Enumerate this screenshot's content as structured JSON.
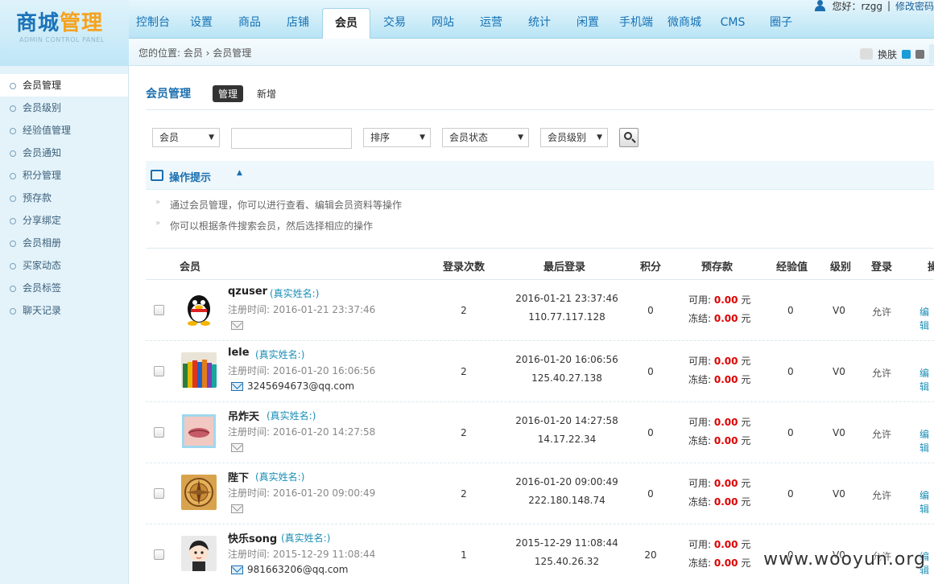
{
  "logo": {
    "part1": "商城",
    "part2": "管理",
    "sub": "ADMIN CONTROL PANEL"
  },
  "nav": {
    "tabs": [
      "控制台",
      "设置",
      "商品",
      "店铺",
      "会员",
      "交易",
      "网站",
      "运营",
      "统计",
      "闲置",
      "手机端",
      "微商城",
      "CMS",
      "圈子"
    ]
  },
  "user": {
    "greeting": "您好：rzgg",
    "change_password": "修改密码"
  },
  "breadcrumb": "您的位置: 会员 › 会员管理",
  "skin": {
    "label": "换肤",
    "colors": [
      "#1b9bd7",
      "#777777"
    ]
  },
  "sidebar": {
    "items": [
      "会员管理",
      "会员级别",
      "经验值管理",
      "会员通知",
      "积分管理",
      "预存款",
      "分享绑定",
      "会员相册",
      "买家动态",
      "会员标签",
      "聊天记录"
    ]
  },
  "page": {
    "title": "会员管理",
    "tab_manage": "管理",
    "tab_new": "新增"
  },
  "filters": {
    "member": "会员",
    "sort": "排序",
    "status": "会员状态",
    "level": "会员级别"
  },
  "tips": {
    "title": "操作提示",
    "lines": [
      "通过会员管理，你可以进行查看、编辑会员资料等操作",
      "你可以根据条件搜索会员，然后选择相应的操作"
    ]
  },
  "table": {
    "headers": {
      "member": "会员",
      "logins": "登录次数",
      "last_login": "最后登录",
      "points": "积分",
      "deposit": "预存款",
      "exp": "经验值",
      "level": "级别",
      "login": "登录"
    },
    "rows": [
      {
        "username": "qzuser",
        "realname": "(真实姓名:)",
        "regtime": "注册时间: 2016-01-21 23:37:46",
        "email": "",
        "logins": "2",
        "last_time": "2016-01-21 23:37:46",
        "last_ip": "110.77.117.128",
        "points": "0",
        "available_label": "可用:",
        "available_value": "0.00",
        "available_unit": "元",
        "frozen_label": "冻结:",
        "frozen_value": "0.00",
        "frozen_unit": "元",
        "exp": "0",
        "level": "V0",
        "login": "允许",
        "action": "编辑"
      },
      {
        "username": "lele",
        "realname": "(真实姓名:)",
        "regtime": "注册时间: 2016-01-20 16:06:56",
        "email": "3245694673@qq.com",
        "logins": "2",
        "last_time": "2016-01-20 16:06:56",
        "last_ip": "125.40.27.138",
        "points": "0",
        "available_label": "可用:",
        "available_value": "0.00",
        "available_unit": "元",
        "frozen_label": "冻结:",
        "frozen_value": "0.00",
        "frozen_unit": "元",
        "exp": "0",
        "level": "V0",
        "login": "允许",
        "action": "编辑"
      },
      {
        "username": "吊炸天",
        "realname": "(真实姓名:)",
        "regtime": "注册时间: 2016-01-20 14:27:58",
        "email": "",
        "logins": "2",
        "last_time": "2016-01-20 14:27:58",
        "last_ip": "14.17.22.34",
        "points": "0",
        "available_label": "可用:",
        "available_value": "0.00",
        "available_unit": "元",
        "frozen_label": "冻结:",
        "frozen_value": "0.00",
        "frozen_unit": "元",
        "exp": "0",
        "level": "V0",
        "login": "允许",
        "action": "编辑"
      },
      {
        "username": "陛下",
        "realname": "(真实姓名:)",
        "regtime": "注册时间: 2016-01-20 09:00:49",
        "email": "",
        "logins": "2",
        "last_time": "2016-01-20 09:00:49",
        "last_ip": "222.180.148.74",
        "points": "0",
        "available_label": "可用:",
        "available_value": "0.00",
        "available_unit": "元",
        "frozen_label": "冻结:",
        "frozen_value": "0.00",
        "frozen_unit": "元",
        "exp": "0",
        "level": "V0",
        "login": "允许",
        "action": "编辑"
      },
      {
        "username": "快乐song",
        "realname": "(真实姓名:)",
        "regtime": "注册时间: 2015-12-29 11:08:44",
        "email": "981663206@qq.com",
        "logins": "1",
        "last_time": "2015-12-29 11:08:44",
        "last_ip": "125.40.26.32",
        "points": "20",
        "available_label": "可用:",
        "available_value": "0.00",
        "available_unit": "元",
        "frozen_label": "冻结:",
        "frozen_value": "0.00",
        "frozen_unit": "元",
        "exp": "0",
        "level": "V0",
        "login": "允许",
        "action": "编辑"
      }
    ]
  },
  "watermark": "www.wooyun.org"
}
